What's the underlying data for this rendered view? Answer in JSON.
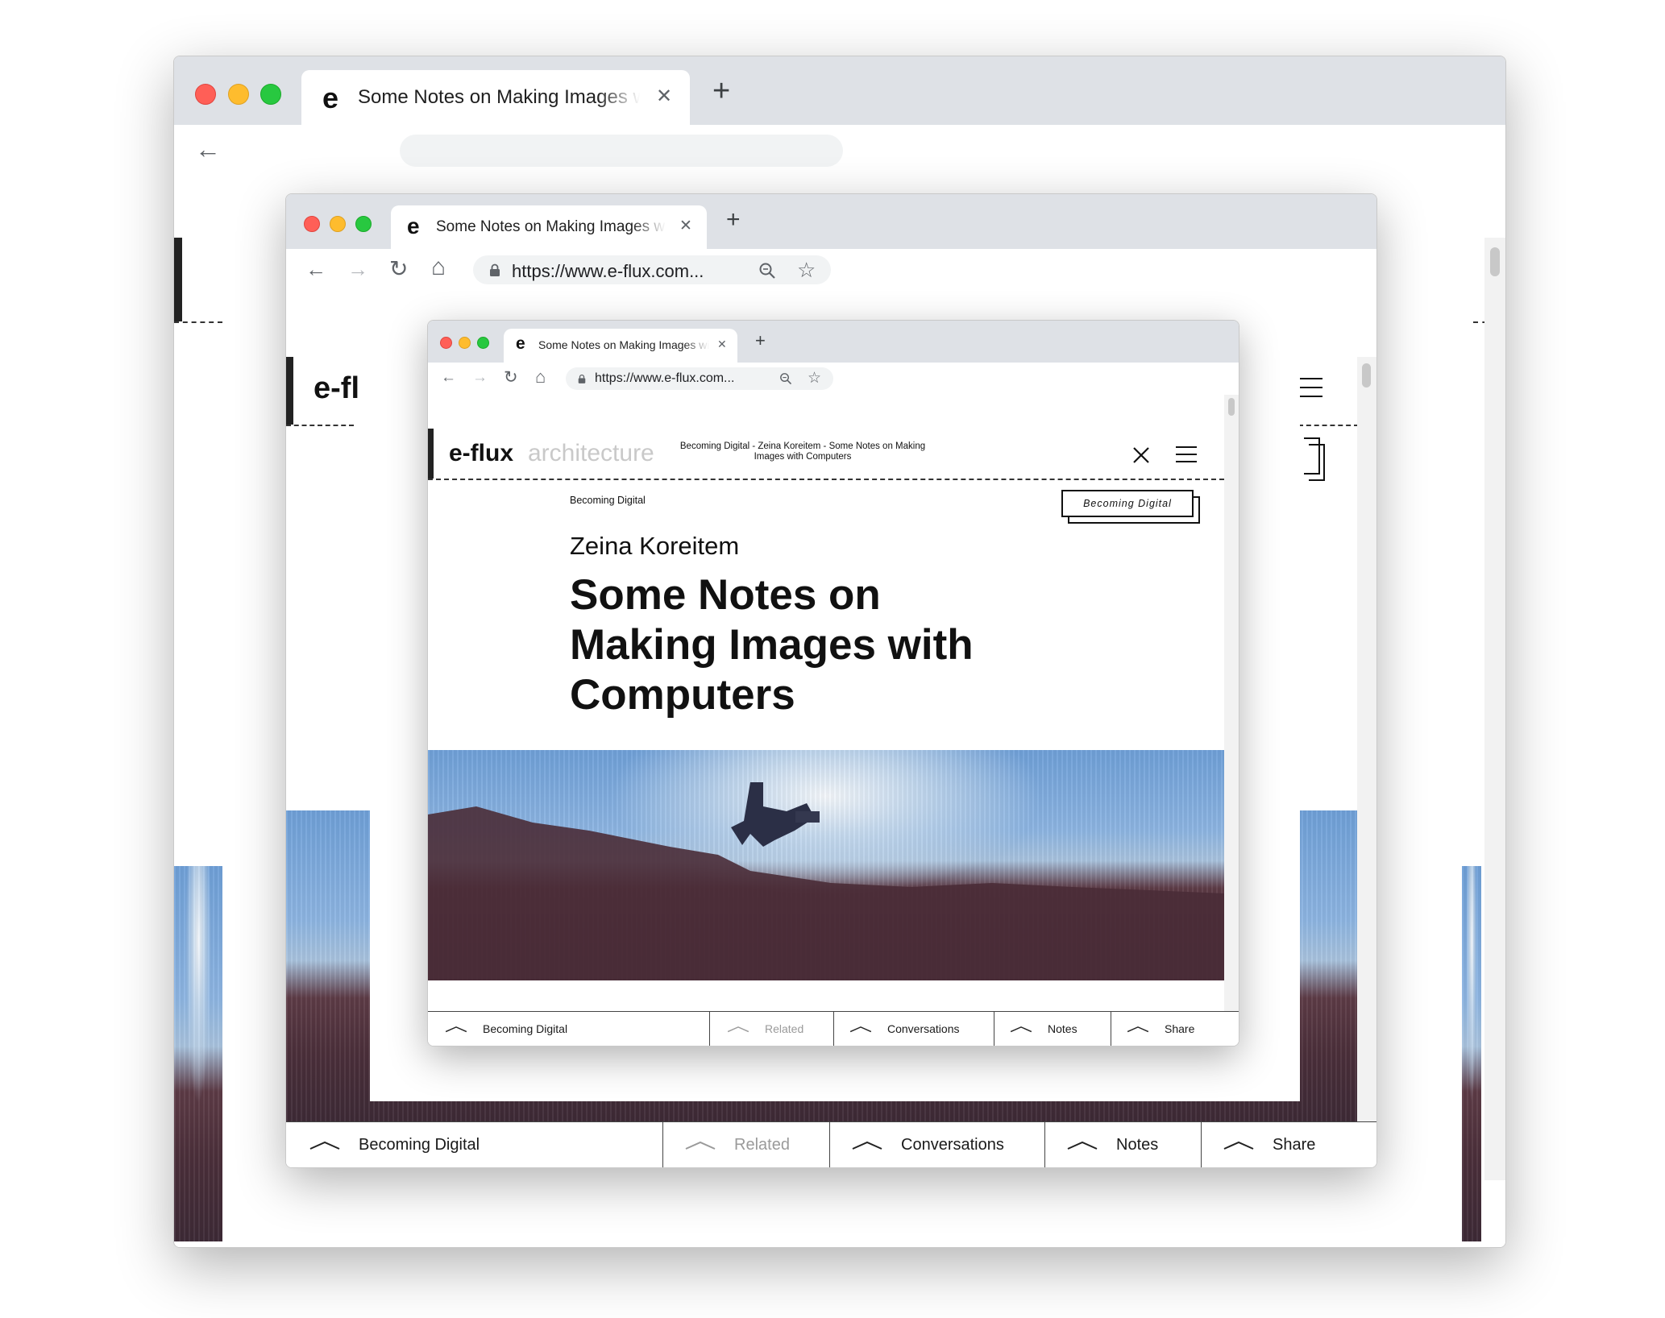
{
  "tab": {
    "favicon": "e",
    "title": "Some Notes on Making Images with Computers",
    "close": "✕",
    "new_tab": "+"
  },
  "omnibox": {
    "url": "https://www.e-flux.com...",
    "lock_icon": "lock-icon",
    "zoom_icon": "zoom-icon",
    "star_icon": "star-icon"
  },
  "nav": {
    "back": "←",
    "forward": "→",
    "reload": "↻",
    "home": "⌂"
  },
  "outer": {
    "logo_partial": "e-fl",
    "logo_sliver": "e-flux"
  },
  "site": {
    "logo": "e-flux",
    "logo_sub": "architecture",
    "breadcrumb": "Becoming Digital - Zeina Koreitem - Some Notes on Making Images with Computers",
    "kicker": "Becoming Digital",
    "badge": "Becoming Digital",
    "author": "Zeina Koreitem",
    "title": "Some Notes on Making Images with Computers"
  },
  "bottom_bar": [
    {
      "label": "Becoming Digital",
      "dim": false
    },
    {
      "label": "Related",
      "dim": true
    },
    {
      "label": "Conversations",
      "dim": false
    },
    {
      "label": "Notes",
      "dim": false
    },
    {
      "label": "Share",
      "dim": false
    }
  ],
  "colors": {
    "tabbar": "#dee1e6",
    "omnibox": "#f1f3f4",
    "close_red": "#ff5f57",
    "min_yellow": "#febc2e",
    "max_green": "#28c840",
    "dim_text": "#9a9a9a",
    "logo_sub": "#c9c9c9"
  }
}
